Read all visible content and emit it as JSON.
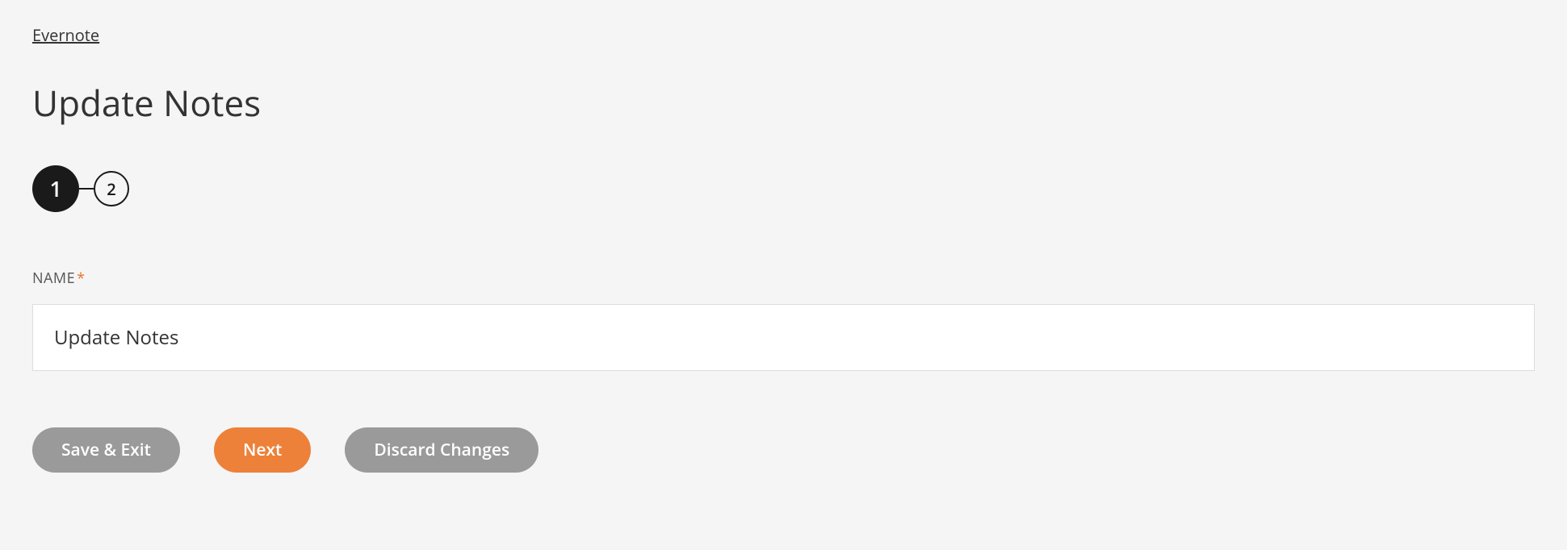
{
  "breadcrumb": {
    "label": "Evernote"
  },
  "page_title": "Update Notes",
  "stepper": {
    "step1": "1",
    "step2": "2"
  },
  "form": {
    "name_label": "NAME",
    "required_mark": "*",
    "name_value": "Update Notes"
  },
  "buttons": {
    "save_exit": "Save & Exit",
    "next": "Next",
    "discard": "Discard Changes"
  }
}
